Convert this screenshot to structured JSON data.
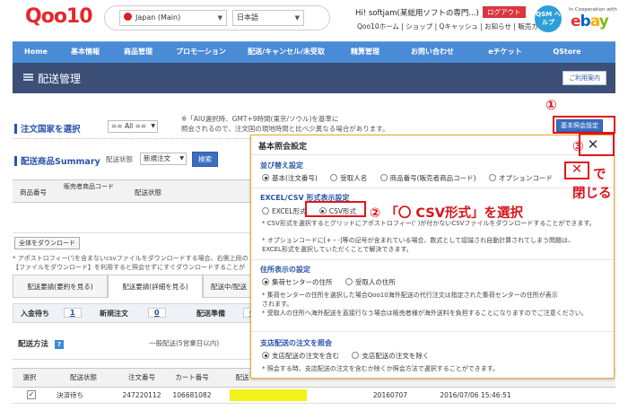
{
  "header": {
    "logo_text": "Qoo10",
    "country_select": "Japan (Main)",
    "language_select": "日本語",
    "greeting": "Hi! softjam(某総用ソフトの専門...)",
    "logout_label": "ログアウト",
    "top_links": "Qoo10ホーム | ショップ | Qキャッシュ | お知らせ | 販売ガイド",
    "qsm_help": "QSM ヘルプ",
    "ebay_note": "In Cooperation with",
    "ebay_logo": "ebay"
  },
  "nav": {
    "items": [
      "Home",
      "基本情報",
      "商品管理",
      "プロモーション",
      "配送/キャンセル/未受取",
      "精算管理",
      "お問い合わせ",
      "eチケット",
      "QStore"
    ]
  },
  "page": {
    "title": "配送管理",
    "guide_button": "ご利用案内"
  },
  "filters": {
    "country_title": "注文国家を選択",
    "country_value": "== All ==",
    "country_note_line1": "※「AIU選択時、GMT+9時間(東京/ソウル)を基準に",
    "country_note_line2": "照会されるので、注文国の現地時間と比べ少異なる場合があります。",
    "summary_title": "配送商品Summary",
    "status_label": "配送状態",
    "status_value": "新規注文",
    "search_button": "検索",
    "basic_settings_button": "基本照会設定"
  },
  "summary_table": {
    "headers": [
      "商品番号",
      "販売者商品コード",
      "配送状態"
    ],
    "download_all": "全体をダウンロード",
    "note_line1": "* アポストロフィー(')を含まないcsvファイルをダウンロードする場合、右側上段の",
    "note_line2": "【ファイルをダウンロード】を利用すると照会せずにすぐダウンロードすることが"
  },
  "tabs": [
    "配送要請(要約を見る)",
    "配送要請(詳細を見る)",
    "配送中/配送"
  ],
  "stats": {
    "pending_label": "入金待ち",
    "pending_value": "1",
    "new_label": "新規注文",
    "new_value": "0",
    "ready_label": "配送準備",
    "ready_value": "0"
  },
  "shipping_method": {
    "label": "配送方法",
    "help": "?",
    "general_label": "一般配送(5営業日以内)"
  },
  "orders_grid": {
    "headers": [
      "選択",
      "配送状態",
      "注文番号",
      "カート番号",
      "配送"
    ],
    "rows": [
      {
        "status": "決済待ち",
        "order_no": "247220112",
        "cart_no": "106681082",
        "date": "20160707",
        "time": "2016/07/06 15:46:51",
        "checked": true
      }
    ]
  },
  "modal": {
    "title": "基本照会設定",
    "close_label": "✕",
    "sort_title": "並び替え設定",
    "sort_options": [
      "基本(注文番号)",
      "受取人名",
      "商品番号(販売者商品コード)",
      "オプションコード"
    ],
    "csv_title": "EXCEL/CSV 形式表示設定",
    "csv_options": [
      "EXCEL形式",
      "CSV形式"
    ],
    "csv_note1": "* CSV形式を選択するとグリッドにアポストロフィー(' )が付かないCSVファイルをダウンロードすることができます。",
    "csv_note2": "* オプションコードに[+・-]等の記号が含まれている場合、数式として認識され自動計算されてしまう問題は、",
    "csv_note3": "EXCEL形式を選択していただくことで解決できます。",
    "address_title": "住所表示の設定",
    "address_options": [
      "集荷センターの住所",
      "受取人の住所"
    ],
    "address_note1": "* 集荷センターの住所を選択した場合Qoo10海外配送の代行注文は指定された集荷センターの住所が表示",
    "address_note1b": "されます。",
    "address_note2": "* 受取人の住所へ海外配送を直接行なう場合は販売者様が海外送料を負担することになりますのでご注意ください。",
    "branch_title": "支店配送の注文を照会",
    "branch_options": [
      "支店配送の注文を含む",
      "支店配送の注文を除く"
    ],
    "branch_note": "* 照会する時、支店配送の注文を含むか除くか照会方法で選択することができます。"
  },
  "annotations": {
    "step1": "①",
    "step2": "② 「〇 CSV形式」を選択",
    "step3": "③",
    "close_mark": "✕",
    "close_tail": "で",
    "close_text": "閉じる"
  }
}
